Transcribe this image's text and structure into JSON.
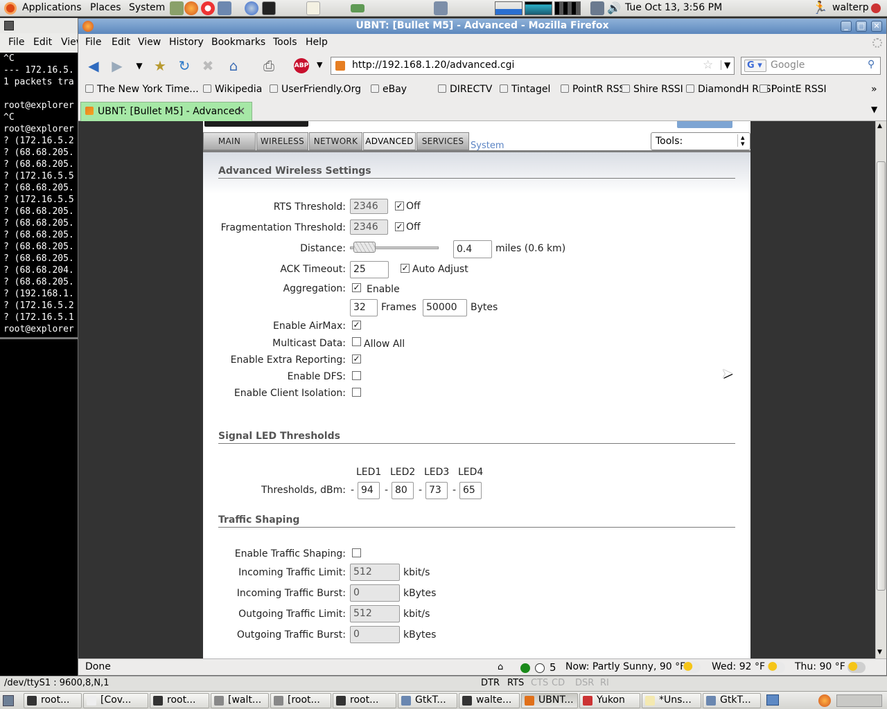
{
  "top_panel": {
    "menus": [
      "Applications",
      "Places",
      "System"
    ],
    "clock": "Tue Oct 13,  3:56 PM",
    "user": "walterp"
  },
  "terminal": {
    "menus": [
      "File",
      "Edit",
      "View"
    ],
    "lines": [
      "^C",
      "--- 172.16.5.",
      "1 packets tra",
      "",
      "root@explorer",
      "^C",
      "root@explorer",
      "? (172.16.5.2",
      "? (68.68.205.",
      "? (68.68.205.",
      "? (172.16.5.5",
      "? (68.68.205.",
      "? (172.16.5.5",
      "? (68.68.205.",
      "? (68.68.205.",
      "? (68.68.205.",
      "? (68.68.205.",
      "? (68.68.205.",
      "? (68.68.204.",
      "? (68.68.205.",
      "? (192.168.1.",
      "? (172.16.5.2",
      "? (172.16.5.1",
      "root@explorer"
    ]
  },
  "serial": {
    "port": "/dev/ttyS1 : 9600,8,N,1",
    "signals": [
      {
        "name": "DTR",
        "active": true
      },
      {
        "name": "RTS",
        "active": true
      },
      {
        "name": "CTS",
        "active": false
      },
      {
        "name": "CD",
        "active": false
      },
      {
        "name": "DSR",
        "active": false
      },
      {
        "name": "RI",
        "active": false
      }
    ]
  },
  "firefox": {
    "title": "UBNT: [Bullet M5] - Advanced - Mozilla Firefox",
    "menus": [
      "File",
      "Edit",
      "View",
      "History",
      "Bookmarks",
      "Tools",
      "Help"
    ],
    "url": "http://192.168.1.20/advanced.cgi",
    "search_placeholder": "Google",
    "bookmarks": [
      "The New York Time...",
      "Wikipedia",
      "UserFriendly.Org",
      "eBay",
      "DIRECTV",
      "Tintagel",
      "PointR RSSI",
      "Shire RSSI",
      "DiamondH RSSI",
      "PointE RSSI"
    ],
    "tab_title": "UBNT: [Bullet M5] - Advanced",
    "status": {
      "text": "Done",
      "counter": "5",
      "weather_now": "Now: Partly Sunny, 90 °F",
      "weather_wed": "Wed: 92 °F",
      "weather_thu": "Thu: 90 °F"
    }
  },
  "airos": {
    "tabs": [
      "MAIN",
      "WIRELESS",
      "NETWORK",
      "ADVANCED",
      "SERVICES"
    ],
    "active_tab": "ADVANCED",
    "system_link": "System",
    "tools_select": "Tools:",
    "section_wireless": "Advanced Wireless Settings",
    "rts_label": "RTS Threshold:",
    "rts_value": "2346",
    "rts_off_label": "Off",
    "frag_label": "Fragmentation Threshold:",
    "frag_value": "2346",
    "frag_off_label": "Off",
    "distance_label": "Distance:",
    "distance_value": "0.4",
    "distance_unit": "miles (0.6 km)",
    "distance_slider_fraction": 0.05,
    "ack_label": "ACK Timeout:",
    "ack_value": "25",
    "ack_auto_label": "Auto Adjust",
    "aggregation_label": "Aggregation:",
    "aggregation_enable_label": "Enable",
    "aggregation_frames": "32",
    "frames_label": "Frames",
    "aggregation_bytes": "50000",
    "bytes_label": "Bytes",
    "airmax_label": "Enable AirMax:",
    "multicast_label": "Multicast Data:",
    "multicast_allow_label": "Allow All",
    "extra_reporting_label": "Enable Extra Reporting:",
    "dfs_label": "Enable DFS:",
    "client_isolation_label": "Enable Client Isolation:",
    "section_led": "Signal LED Thresholds",
    "led_headers": [
      "LED1",
      "LED2",
      "LED3",
      "LED4"
    ],
    "led_label": "Thresholds, dBm:",
    "led_values": [
      "94",
      "80",
      "73",
      "65"
    ],
    "dash": "-",
    "section_traffic": "Traffic Shaping",
    "traffic_enable_label": "Enable Traffic Shaping:",
    "in_limit_label": "Incoming Traffic Limit:",
    "in_limit_value": "512",
    "in_burst_label": "Incoming Traffic Burst:",
    "in_burst_value": "0",
    "out_limit_label": "Outgoing Traffic Limit:",
    "out_limit_value": "512",
    "out_burst_label": "Outgoing Traffic Burst:",
    "out_burst_value": "0",
    "unit_kbits": "kbit/s",
    "unit_kbytes": "kBytes",
    "check_mark": "✓"
  },
  "taskbar": {
    "tasks": [
      "root...",
      "[Cov...",
      "root...",
      "[walt...",
      "[root...",
      "root...",
      "GtkT...",
      "walte...",
      "UBNT...",
      "Yukon",
      "*Uns...",
      "GtkT..."
    ]
  },
  "colors": {
    "active_tab_green": "#a6e8a6",
    "title_blue": "#5c87bd",
    "system_link_blue": "#5b84c4"
  }
}
